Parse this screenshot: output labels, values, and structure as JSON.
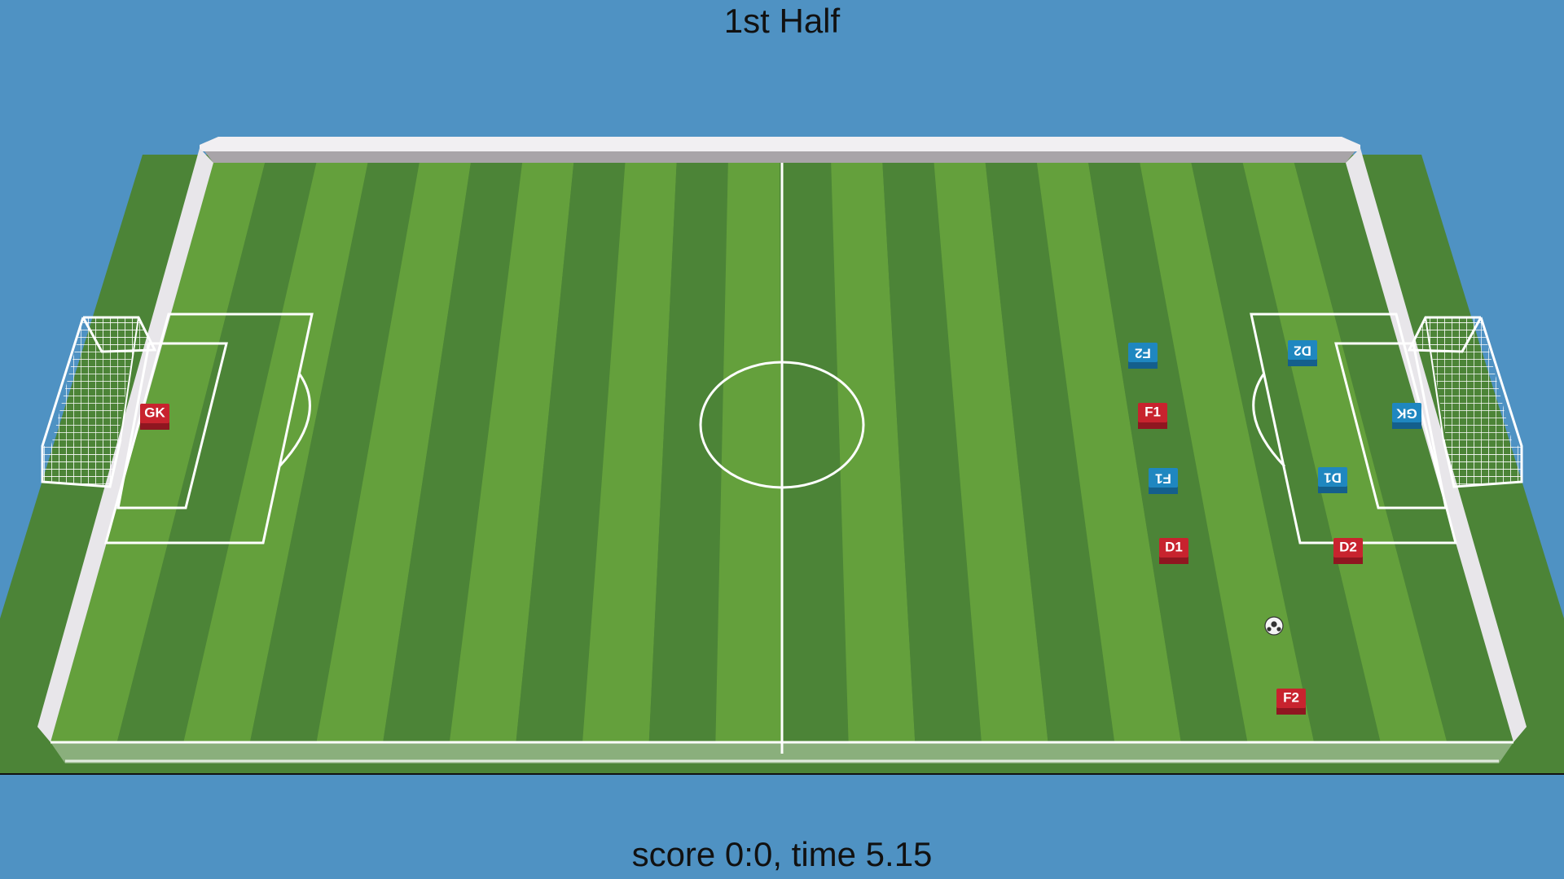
{
  "hud": {
    "half_label": "1st Half",
    "score_line": "score 0:0, time 5.15"
  },
  "game_state": {
    "half": 1,
    "score_home": 0,
    "score_away": 0,
    "time": 5.15
  },
  "teams": {
    "red": {
      "color": "#c8232e",
      "players": [
        "GK",
        "F1",
        "D1",
        "D2",
        "F2"
      ]
    },
    "blue": {
      "color": "#1f87c0",
      "players": [
        "F2",
        "D2",
        "GK",
        "F1",
        "D1"
      ]
    }
  },
  "colors": {
    "sky": "#4f92c3",
    "grass_light": "#64a03c",
    "grass_dark": "#4c8437",
    "wall": "#efedf0",
    "lines": "#ffffff"
  }
}
